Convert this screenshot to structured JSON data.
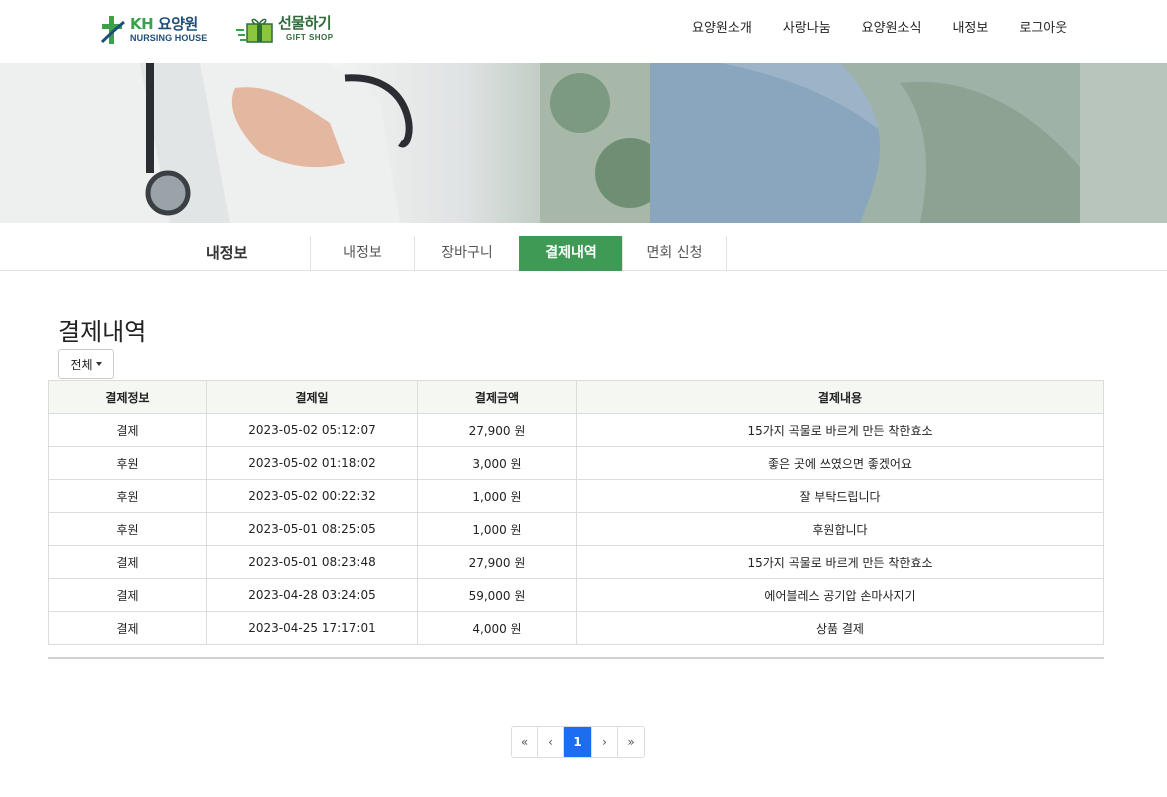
{
  "header": {
    "logo": {
      "brand_prefix": "KH",
      "brand_name": "요양원",
      "subtitle": "NURSING HOUSE"
    },
    "gift_logo": {
      "name": "선물하기",
      "subtitle": "GIFT SHOP"
    },
    "nav": [
      "요양원소개",
      "사랑나눔",
      "요양원소식",
      "내정보",
      "로그아웃"
    ]
  },
  "subnav": {
    "title": "내정보",
    "tabs": [
      {
        "label": "내정보",
        "active": false
      },
      {
        "label": "장바구니",
        "active": false
      },
      {
        "label": "결제내역",
        "active": true
      },
      {
        "label": "면회 신청",
        "active": false
      }
    ]
  },
  "main": {
    "title": "결제내역",
    "filter_label": "전체",
    "table": {
      "headers": [
        "결제정보",
        "결제일",
        "결제금액",
        "결제내용"
      ],
      "rows": [
        [
          "결제",
          "2023-05-02 05:12:07",
          "27,900 원",
          "15가지 곡물로 바르게 만든 착한효소"
        ],
        [
          "후원",
          "2023-05-02 01:18:02",
          "3,000 원",
          "좋은 곳에 쓰였으면 좋겠어요"
        ],
        [
          "후원",
          "2023-05-02 00:22:32",
          "1,000 원",
          "잘 부탁드립니다"
        ],
        [
          "후원",
          "2023-05-01 08:25:05",
          "1,000 원",
          "후원합니다"
        ],
        [
          "결제",
          "2023-05-01 08:23:48",
          "27,900 원",
          "15가지 곡물로 바르게 만든 착한효소"
        ],
        [
          "결제",
          "2023-04-28 03:24:05",
          "59,000 원",
          "에어블레스 공기압 손마사지기"
        ],
        [
          "결제",
          "2023-04-25 17:17:01",
          "4,000 원",
          "상품 결제"
        ]
      ]
    },
    "pagination": {
      "first": "«",
      "prev": "‹",
      "current": "1",
      "next": "›",
      "last": "»"
    }
  },
  "colors": {
    "accent": "#3e9a54",
    "page_active": "#1b6ef3",
    "logo_blue": "#1f4e79",
    "logo_green": "#3aa24a"
  },
  "icons": {
    "logo": "cross-logo-icon",
    "gift": "gift-box-icon",
    "filter": "caret-down-icon"
  }
}
